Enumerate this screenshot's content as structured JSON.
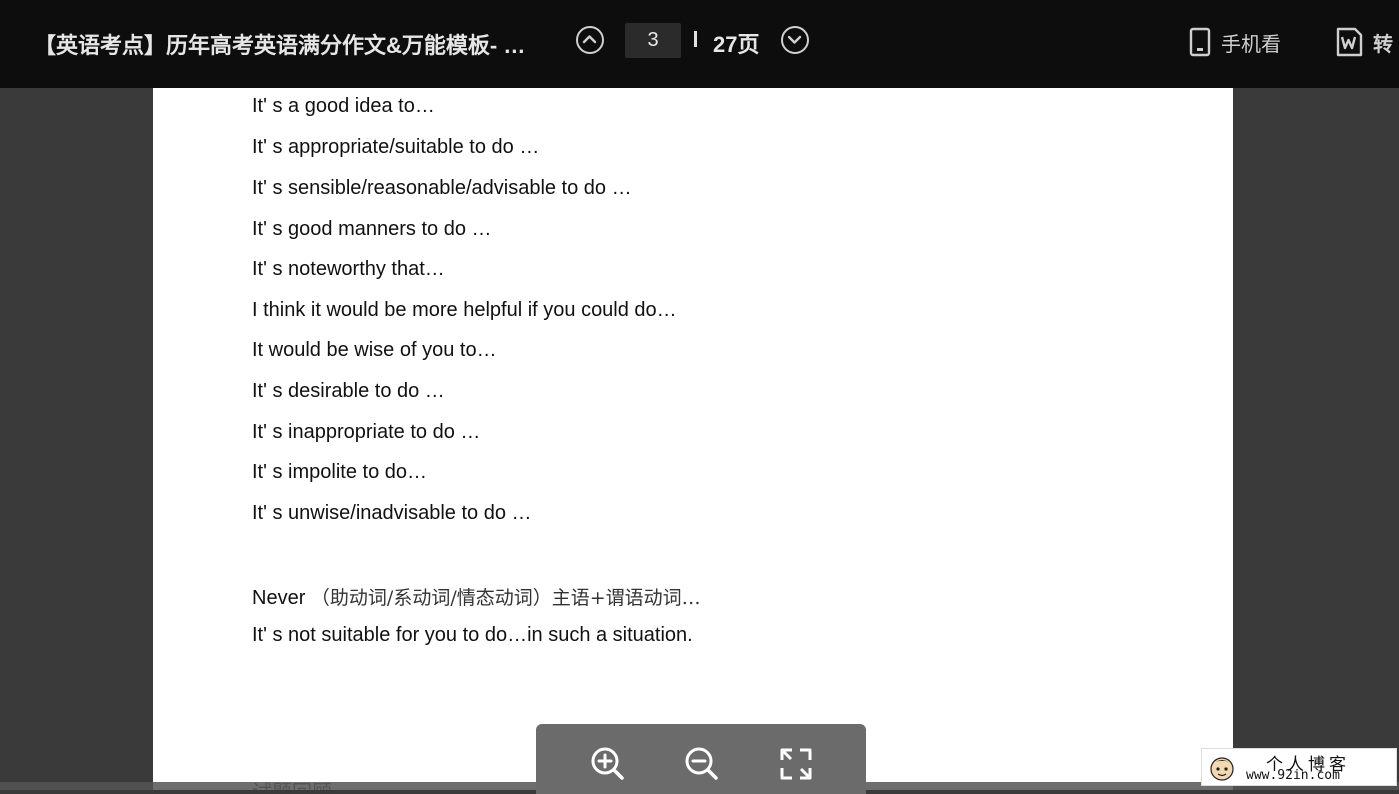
{
  "header": {
    "title": "【英语考点】历年高考英语满分作文&万能模板- …",
    "current_page": "3",
    "page_total_label": "27页",
    "mobile_label": "手机看",
    "convert_label": "转"
  },
  "document": {
    "lines": [
      "It' s a good idea to…",
      "It' s appropriate/suitable to do …",
      "It' s sensible/reasonable/advisable to do …",
      "It' s good manners to do …",
      "It' s noteworthy that…",
      "I think it would be more helpful if you could do…",
      "It would be wise of you to…",
      "It' s desirable to do …",
      "It' s inappropriate to do …",
      "It' s impolite to do…",
      "It' s unwise/inadvisable to do …"
    ],
    "never_prefix": "Never",
    "never_suffix": "（助动词/系动词/情态动词）主语+谓语动词…",
    "last_line": "It' s not suitable for you to do…in such a situation.",
    "faded_heading": "试题回顾"
  },
  "watermark": {
    "text_cn": "个人博客",
    "url": "www.92in.com"
  },
  "icons": {
    "prev": "chevron-up-icon",
    "next": "chevron-down-icon",
    "mobile": "phone-icon",
    "convert": "word-doc-icon",
    "zoom_in": "zoom-in-icon",
    "zoom_out": "zoom-out-icon",
    "fullscreen": "fullscreen-icon"
  }
}
